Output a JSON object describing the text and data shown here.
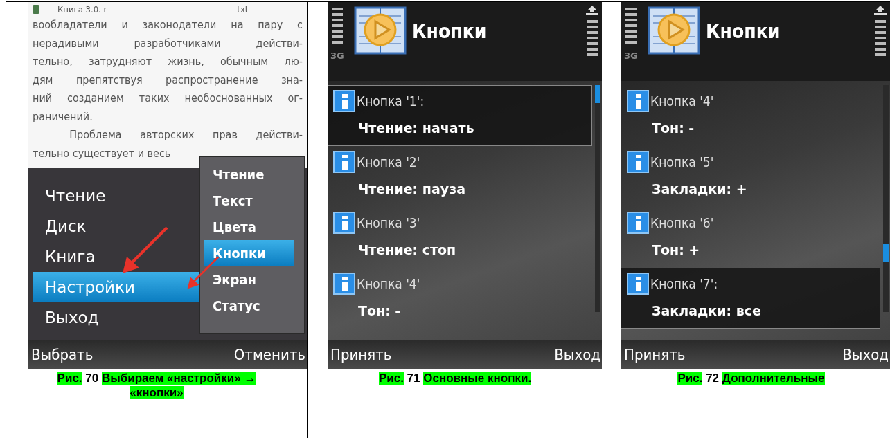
{
  "figures": [
    {
      "kind": "menu",
      "reader": {
        "title_left": "- Книга 3.0. r",
        "title_right": "txt -",
        "lines": [
          "вообладатели и законодатели на пару с",
          "нерадивыми разработчиками действи-",
          "тельно, затрудняют жизнь, обычным лю-",
          "дям препятствуя распространение зна-",
          "ний созданием таких необоснованных ог-",
          "раничений.",
          "  Проблема авторских прав действи-",
          "тельно существует и весь"
        ]
      },
      "menu": [
        {
          "label": "Чтение",
          "selected": false
        },
        {
          "label": "Диск",
          "selected": false
        },
        {
          "label": "Книга",
          "selected": false
        },
        {
          "label": "Настройки",
          "selected": true
        },
        {
          "label": "Выход",
          "selected": false
        }
      ],
      "submenu": [
        {
          "label": "Чтение",
          "selected": false
        },
        {
          "label": "Текст",
          "selected": false
        },
        {
          "label": "Цвета",
          "selected": false
        },
        {
          "label": "Кнопки",
          "selected": true
        },
        {
          "label": "Экран",
          "selected": false
        },
        {
          "label": "Статус",
          "selected": false
        }
      ],
      "softkeys": {
        "left": "Выбрать",
        "right": "Отменить"
      },
      "caption": {
        "label": "Рис.",
        "number": "70",
        "text": "Выбираем «настройки» → «кнопки»"
      }
    },
    {
      "kind": "list",
      "title": "Кнопки",
      "network": "3G",
      "items": [
        {
          "name": "Кнопка '1':",
          "value": "Чтение: начать",
          "selected": true
        },
        {
          "name": "Кнопка '2'",
          "value": "Чтение: пауза",
          "selected": false
        },
        {
          "name": "Кнопка '3'",
          "value": "Чтение: стоп",
          "selected": false
        },
        {
          "name": "Кнопка '4'",
          "value": "Тон: -",
          "selected": false
        }
      ],
      "softkeys": {
        "left": "Принять",
        "right": "Выход"
      },
      "caption": {
        "label": "Рис.",
        "number": "71",
        "text": "Основные кнопки."
      }
    },
    {
      "kind": "list",
      "title": "Кнопки",
      "network": "3G",
      "items": [
        {
          "name": "Кнопка '4'",
          "value": "Тон: -",
          "selected": false
        },
        {
          "name": "Кнопка '5'",
          "value": "Закладки: +",
          "selected": false
        },
        {
          "name": "Кнопка '6'",
          "value": "Тон: +",
          "selected": false
        },
        {
          "name": "Кнопка '7':",
          "value": "Закладки: все",
          "selected": true
        }
      ],
      "softkeys": {
        "left": "Принять",
        "right": "Выход"
      },
      "caption": {
        "label": "Рис.",
        "number": "72",
        "text": "Дополнительные"
      }
    }
  ]
}
